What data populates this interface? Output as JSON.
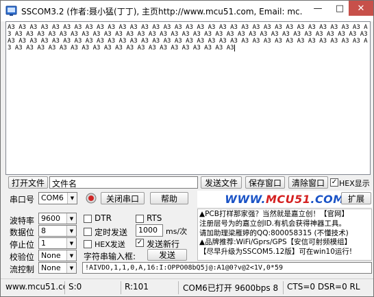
{
  "window": {
    "title": "SSCOM3.2 (作者:聂小猛(丁丁), 主页http://www.mcu51.com,  Email: mc..."
  },
  "receive": {
    "text": "A3 A3 A3 A3 A3 A3 A3 A3 A3 A3 A3 A3 A3 A3 A3 A3 A3 A3 A3 A3 A3 A3 A3 A3 A3 A3 A3 A3 A3 A3 A3 A3 A3 A3 A3 A3 A3 A3 A3 A3 A3 A3 A3 A3 A3 A3 A3 A3 A3 A3 A3 A3 A3 A3 A3 A3 A3 A3 A3 A3 A3 A3 A3 A3 A3 A3 A3 A3 A3 A3 A3 A3 A3 A3 A3 A3 A3 A3 A3 A3 A3 A3 A3 A3 A3 A3 A3 A3 A3 A3 A3 A3 A3 A3 A3 A3 A3 A3 A3 A3 A3 A3 A3 A3 A3 A3 A3 A3 A3 A3 A3 A3 A3 A3 A3 A3 A3 A3"
  },
  "file_row": {
    "open_file": "打开文件",
    "file_name": "文件名",
    "send_file": "发送文件",
    "save_window": "保存窗口",
    "clear_window": "清除窗口",
    "hex_display": "HEX显示"
  },
  "port_row": {
    "port_label": "串口号",
    "port_value": "COM6",
    "close_port": "关闭串口",
    "help": "帮助",
    "extend": "扩展"
  },
  "logo": {
    "www": "WWW.",
    "mcu": "MCU",
    "num": "51",
    "com": ".COM"
  },
  "settings": {
    "baud_label": "波特率",
    "baud_value": "9600",
    "data_label": "数据位",
    "data_value": "8",
    "stop_label": "停止位",
    "stop_value": "1",
    "parity_label": "校验位",
    "parity_value": "None",
    "flow_label": "流控制",
    "flow_value": "None"
  },
  "send_options": {
    "dtr": "DTR",
    "rts": "RTS",
    "timed_send": "定时发送",
    "interval": "1000",
    "interval_unit": "ms/次",
    "hex_send": "HEX发送",
    "send_newline": "发送新行",
    "input_label": "字符串输入框:",
    "send_button": "发送",
    "input_value": "!AIVDO,1,1,0,A,16:I:OPPO08bQ5j@:A1@0?v@2<1V,0*59"
  },
  "ad": {
    "line1": "▲PCB打样那家强？当然就是嘉立创！【官网】",
    "line2": "注册层号为的嘉立创ID.有机会获得神器工具。",
    "line3": "请加助理梁雁婷的QQ:800058315 (不懂技术)",
    "line4": "▲品牌推荐:WiFi/Gprs/GPS【安信可射频模组】",
    "line5": "【尽早升级为SSCOM5.12版】可在win10运行!"
  },
  "status": {
    "site": "www.mcu51.cor",
    "sent": "S:0",
    "received": "R:101",
    "port_state": "COM6已打开  9600bps  8",
    "lines": "CTS=0 DSR=0 RL"
  },
  "colors": {
    "close_button": "#c7504a",
    "logo_blue": "#1a53c6",
    "logo_red": "#d42020"
  }
}
